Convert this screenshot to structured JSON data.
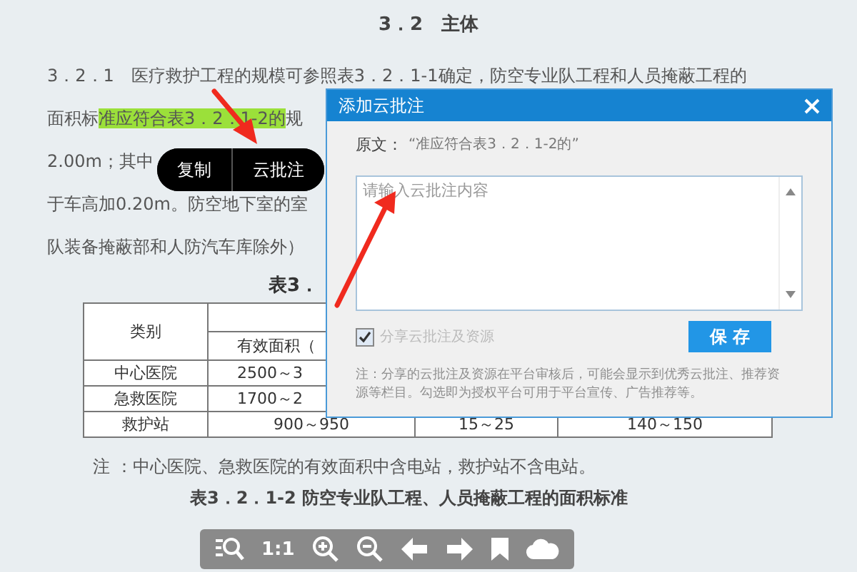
{
  "document": {
    "heading": "3．2　主体",
    "lines": [
      {
        "parts": [
          {
            "text": "3．2．1　医疗救护工程的规模可参照表3．2．1-1确定，防空专业队工程和人员掩蔽工程的",
            "highlighted": false
          }
        ]
      },
      {
        "parts": [
          {
            "text": "面积标",
            "highlighted": false
          },
          {
            "text": "准应符合表3．2．1-2的",
            "highlighted": true
          },
          {
            "text": "规",
            "highlighted": false
          }
        ]
      },
      {
        "parts": [
          {
            "text": "2.00m；其中",
            "highlighted": false
          }
        ]
      },
      {
        "parts": [
          {
            "text": "于车高加0.20m。防空地下室的室",
            "highlighted": false
          }
        ]
      },
      {
        "parts": [
          {
            "text": "队装备掩蔽部和人防汽车库除外）",
            "highlighted": false
          }
        ]
      }
    ],
    "table_caption": "表3．",
    "table": {
      "category_header": "类别",
      "area_header": "有效面积（",
      "rows": [
        {
          "cells": [
            "中心医院",
            "2500～3"
          ]
        },
        {
          "cells": [
            "急救医院",
            "1700～2"
          ]
        },
        {
          "cells": [
            "救护站",
            "900～950",
            "15～25",
            "140～150"
          ]
        }
      ]
    },
    "note": "注 ：中心医院、急救医院的有效面积中含电站，救护站不含电站。",
    "caption": "表3．2．1-2 防空专业队工程、人员掩蔽工程的面积标准"
  },
  "popup_menu": {
    "items": [
      "复制",
      "云批注"
    ]
  },
  "dialog": {
    "title": "添加云批注",
    "source_label": "原文：",
    "source_text": "“准应符合表3．2．1-2的”",
    "placeholder": "请输入云批注内容",
    "share_label": "分享云批注及资源",
    "share_checked": true,
    "save_button": "保 存",
    "notice": "注：分享的云批注及资源在平台审核后，可能会显示到优秀云批注、推荐资源等栏目。勾选即为授权平台可用于平台宣传、广告推荐等。"
  },
  "toolbar": {
    "zoom_ratio": "1:1"
  }
}
